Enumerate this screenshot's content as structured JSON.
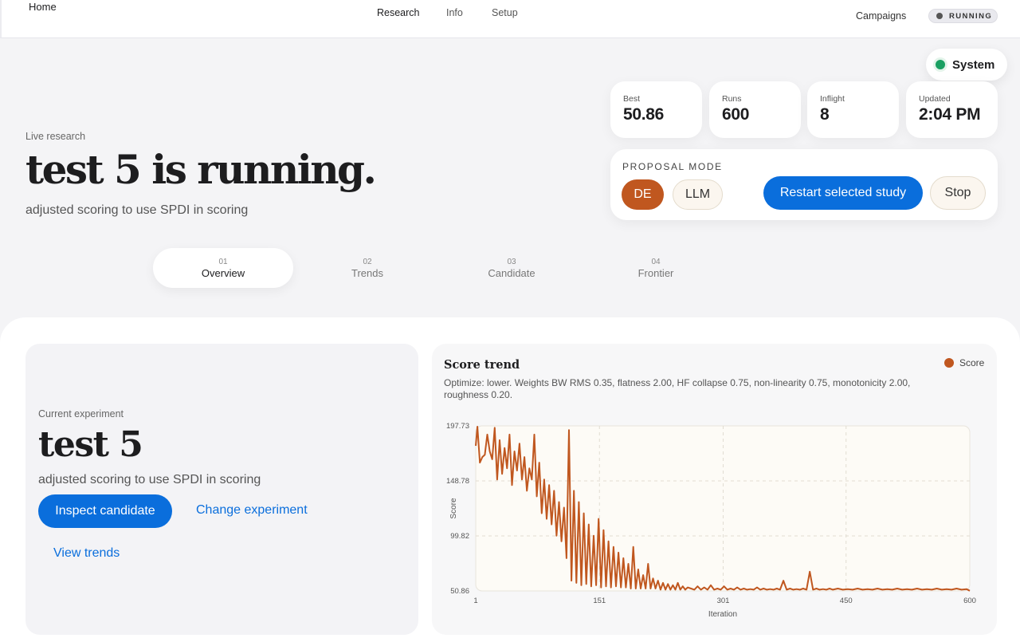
{
  "topbar": {
    "home": "Home",
    "nav": [
      "Research",
      "Info",
      "Setup"
    ],
    "campaigns": "Campaigns",
    "status": "RUNNING"
  },
  "system_badge": "System",
  "stats": [
    {
      "label": "Best",
      "value": "50.86"
    },
    {
      "label": "Runs",
      "value": "600"
    },
    {
      "label": "Inflight",
      "value": "8"
    },
    {
      "label": "Updated",
      "value": "2:04 PM"
    }
  ],
  "proposal": {
    "label": "PROPOSAL MODE",
    "modes": [
      "DE",
      "LLM"
    ],
    "selected": "DE",
    "restart": "Restart selected study",
    "stop": "Stop"
  },
  "hero": {
    "eyebrow": "Live research",
    "title": "test 5 is running.",
    "subtitle": "adjusted scoring to use SPDI in scoring"
  },
  "tabs": [
    {
      "num": "01",
      "name": "Overview"
    },
    {
      "num": "02",
      "name": "Trends"
    },
    {
      "num": "03",
      "name": "Candidate"
    },
    {
      "num": "04",
      "name": "Frontier"
    }
  ],
  "experiment": {
    "eyebrow": "Current experiment",
    "title": "test 5",
    "subtitle": "adjusted scoring to use SPDI in scoring",
    "inspect": "Inspect candidate",
    "change": "Change experiment",
    "trends": "View trends"
  },
  "chart_data": {
    "type": "line",
    "title": "Score trend",
    "description": "Optimize: lower. Weights BW RMS 0.35, flatness 2.00, HF collapse 0.75, non-linearity 0.75, monotonicity 2.00, roughness 0.20.",
    "xlabel": "Iteration",
    "ylabel": "Score",
    "xlim": [
      1,
      600
    ],
    "ylim": [
      50.86,
      197.73
    ],
    "x_ticks": [
      "1",
      "151",
      "301",
      "450",
      "600"
    ],
    "y_ticks": [
      "197.73",
      "148.78",
      "99.82",
      "50.86"
    ],
    "legend_position": "top-right",
    "grid": true,
    "series": [
      {
        "name": "Score",
        "color": "#c0571f",
        "points": [
          [
            1,
            180
          ],
          [
            3,
            197
          ],
          [
            6,
            165
          ],
          [
            9,
            170
          ],
          [
            12,
            172
          ],
          [
            15,
            190
          ],
          [
            18,
            175
          ],
          [
            21,
            168
          ],
          [
            24,
            196
          ],
          [
            27,
            150
          ],
          [
            30,
            185
          ],
          [
            33,
            155
          ],
          [
            36,
            178
          ],
          [
            39,
            160
          ],
          [
            42,
            190
          ],
          [
            45,
            145
          ],
          [
            48,
            175
          ],
          [
            51,
            158
          ],
          [
            54,
            182
          ],
          [
            57,
            150
          ],
          [
            60,
            170
          ],
          [
            63,
            140
          ],
          [
            66,
            160
          ],
          [
            69,
            150
          ],
          [
            72,
            190
          ],
          [
            75,
            135
          ],
          [
            78,
            165
          ],
          [
            81,
            120
          ],
          [
            84,
            150
          ],
          [
            87,
            115
          ],
          [
            90,
            145
          ],
          [
            93,
            110
          ],
          [
            96,
            140
          ],
          [
            99,
            100
          ],
          [
            102,
            130
          ],
          [
            105,
            95
          ],
          [
            108,
            125
          ],
          [
            111,
            80
          ],
          [
            114,
            194
          ],
          [
            117,
            60
          ],
          [
            120,
            140
          ],
          [
            123,
            58
          ],
          [
            126,
            130
          ],
          [
            129,
            56
          ],
          [
            132,
            120
          ],
          [
            135,
            57
          ],
          [
            138,
            110
          ],
          [
            141,
            55
          ],
          [
            144,
            100
          ],
          [
            147,
            56
          ],
          [
            150,
            115
          ],
          [
            153,
            54
          ],
          [
            156,
            105
          ],
          [
            159,
            55
          ],
          [
            162,
            95
          ],
          [
            165,
            54
          ],
          [
            168,
            90
          ],
          [
            171,
            55
          ],
          [
            174,
            85
          ],
          [
            177,
            54
          ],
          [
            180,
            80
          ],
          [
            183,
            54
          ],
          [
            186,
            75
          ],
          [
            189,
            53
          ],
          [
            192,
            90
          ],
          [
            195,
            53
          ],
          [
            198,
            70
          ],
          [
            201,
            53
          ],
          [
            204,
            65
          ],
          [
            207,
            53
          ],
          [
            210,
            75
          ],
          [
            213,
            53
          ],
          [
            216,
            62
          ],
          [
            219,
            53
          ],
          [
            222,
            60
          ],
          [
            225,
            52
          ],
          [
            228,
            58
          ],
          [
            231,
            52
          ],
          [
            234,
            57
          ],
          [
            237,
            52
          ],
          [
            240,
            56
          ],
          [
            243,
            52
          ],
          [
            246,
            58
          ],
          [
            249,
            52
          ],
          [
            252,
            55
          ],
          [
            255,
            52
          ],
          [
            258,
            54
          ],
          [
            262,
            53
          ],
          [
            266,
            52
          ],
          [
            270,
            55
          ],
          [
            274,
            52
          ],
          [
            278,
            54
          ],
          [
            282,
            52
          ],
          [
            286,
            56
          ],
          [
            290,
            52
          ],
          [
            294,
            53
          ],
          [
            298,
            52
          ],
          [
            302,
            55
          ],
          [
            306,
            52
          ],
          [
            310,
            53
          ],
          [
            314,
            52
          ],
          [
            318,
            54
          ],
          [
            322,
            52
          ],
          [
            326,
            53
          ],
          [
            330,
            52
          ],
          [
            334,
            52.5
          ],
          [
            338,
            52
          ],
          [
            342,
            54
          ],
          [
            346,
            52
          ],
          [
            350,
            53
          ],
          [
            354,
            52
          ],
          [
            358,
            52.5
          ],
          [
            362,
            52
          ],
          [
            366,
            53
          ],
          [
            370,
            52
          ],
          [
            374,
            60
          ],
          [
            378,
            52
          ],
          [
            382,
            53
          ],
          [
            386,
            52
          ],
          [
            390,
            52.5
          ],
          [
            394,
            52
          ],
          [
            398,
            53
          ],
          [
            402,
            52
          ],
          [
            406,
            68
          ],
          [
            410,
            52
          ],
          [
            414,
            53
          ],
          [
            418,
            52
          ],
          [
            422,
            52.5
          ],
          [
            426,
            52
          ],
          [
            430,
            53
          ],
          [
            434,
            52
          ],
          [
            440,
            53
          ],
          [
            446,
            52
          ],
          [
            452,
            52.5
          ],
          [
            458,
            52
          ],
          [
            464,
            53
          ],
          [
            470,
            52
          ],
          [
            476,
            52.5
          ],
          [
            482,
            52
          ],
          [
            488,
            53
          ],
          [
            494,
            52
          ],
          [
            500,
            52.5
          ],
          [
            506,
            52
          ],
          [
            512,
            53
          ],
          [
            518,
            52
          ],
          [
            524,
            52.5
          ],
          [
            530,
            52
          ],
          [
            536,
            53
          ],
          [
            542,
            52
          ],
          [
            548,
            52.5
          ],
          [
            554,
            52
          ],
          [
            560,
            53
          ],
          [
            566,
            52
          ],
          [
            572,
            52.5
          ],
          [
            578,
            52
          ],
          [
            584,
            53
          ],
          [
            590,
            52
          ],
          [
            596,
            52.5
          ],
          [
            600,
            51
          ]
        ]
      }
    ]
  }
}
